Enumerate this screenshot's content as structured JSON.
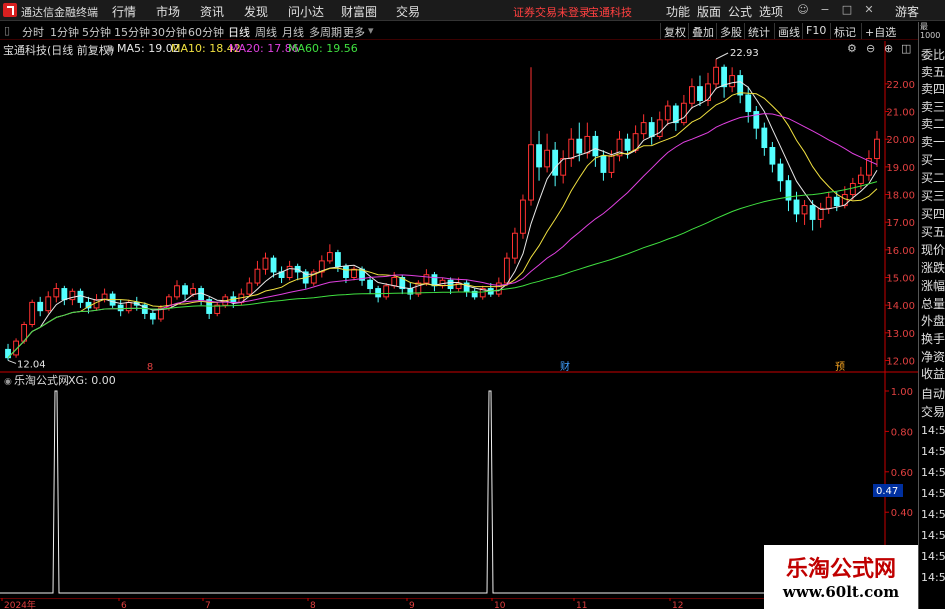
{
  "menubar": {
    "app_title": "通达信金融终端",
    "menus": [
      "行情",
      "市场",
      "资讯",
      "发现",
      "问小达",
      "财富圈",
      "交易"
    ],
    "status_text": "证券交易未登录",
    "stock_name": "宝通科技",
    "right_menus": [
      "功能",
      "版面",
      "公式",
      "选项"
    ],
    "user": "游客"
  },
  "toolbar": {
    "periods": [
      "分时",
      "1分钟",
      "5分钟",
      "15分钟",
      "30分钟",
      "60分钟",
      "日线",
      "周线",
      "月线",
      "多周期",
      "更多"
    ],
    "active_period": "日线",
    "right_buttons": [
      "复权",
      "叠加",
      "多股",
      "统计",
      "画线",
      "F10",
      "标记",
      "+自选"
    ]
  },
  "info": {
    "title": "宝通科技(日线 前复权)",
    "ma5": "MA5: 19.02",
    "ma10": "MA10: 18.42",
    "ma20": "MA20: 17.86",
    "ma60": "MA60: 19.56"
  },
  "colors": {
    "up": "#ff3232",
    "down": "#54ffff",
    "ma5": "#e8e8e8",
    "ma10": "#f0e040",
    "ma20": "#e040e0",
    "ma60": "#40e040",
    "grid": "#5a0000",
    "axis": "#c80000"
  },
  "price_axis": {
    "labels": [
      "22.00",
      "21.00",
      "20.00",
      "19.00",
      "18.00",
      "17.00",
      "16.00",
      "15.00",
      "14.00",
      "13.00",
      "12.00"
    ],
    "high_label": "22.93",
    "low_label": "12.04"
  },
  "markers": [
    "8",
    "财",
    "预"
  ],
  "sub_indicator": {
    "title": "乐淘公式网",
    "value": "XG: 0.00",
    "axis_labels": [
      "1.00",
      "0.80",
      "0.60",
      "0.40",
      "0.20"
    ],
    "cursor_value": "0.47"
  },
  "x_axis": {
    "labels": [
      "2024年",
      "6",
      "7",
      "8",
      "9",
      "10",
      "11",
      "12"
    ]
  },
  "right_panel": {
    "top_small": [
      "最",
      "1000"
    ],
    "labels": [
      "委比",
      "卖五",
      "卖四",
      "卖三",
      "卖二",
      "卖一",
      "买一",
      "买二",
      "买三",
      "买四",
      "买五",
      "现价",
      "涨跌",
      "涨幅",
      "总量",
      "外盘",
      "换手",
      "净资",
      "收益",
      "自动",
      "交易"
    ],
    "times": [
      "14:56",
      "14:56",
      "14:56",
      "14:56",
      "14:56",
      "14:56",
      "14:56",
      "14:56"
    ]
  },
  "watermark": {
    "title": "乐淘公式网",
    "url": "www.60lt.com"
  },
  "chart_data": {
    "type": "candlestick",
    "ylim": [
      11.8,
      22.9
    ],
    "candles": [
      [
        12.4,
        12.1,
        12.6,
        12.0
      ],
      [
        12.2,
        12.7,
        12.8,
        12.1
      ],
      [
        12.7,
        13.3,
        13.4,
        12.6
      ],
      [
        13.3,
        14.1,
        14.2,
        13.2
      ],
      [
        14.1,
        13.8,
        14.3,
        13.6
      ],
      [
        13.8,
        14.3,
        14.5,
        13.7
      ],
      [
        14.3,
        14.6,
        14.8,
        14.1
      ],
      [
        14.6,
        14.2,
        14.7,
        14.0
      ],
      [
        14.2,
        14.5,
        14.6,
        14.0
      ],
      [
        14.5,
        14.1,
        14.6,
        13.9
      ],
      [
        14.1,
        13.9,
        14.3,
        13.7
      ],
      [
        13.9,
        14.2,
        14.4,
        13.8
      ],
      [
        14.2,
        14.4,
        14.6,
        14.1
      ],
      [
        14.4,
        14.0,
        14.5,
        13.9
      ],
      [
        14.0,
        13.8,
        14.2,
        13.6
      ],
      [
        13.8,
        14.1,
        14.2,
        13.7
      ],
      [
        14.1,
        14.0,
        14.3,
        13.8
      ],
      [
        14.0,
        13.7,
        14.1,
        13.5
      ],
      [
        13.7,
        13.5,
        13.8,
        13.3
      ],
      [
        13.5,
        13.9,
        14.0,
        13.4
      ],
      [
        13.9,
        14.3,
        14.4,
        13.8
      ],
      [
        14.3,
        14.7,
        14.9,
        14.2
      ],
      [
        14.7,
        14.4,
        14.8,
        14.2
      ],
      [
        14.4,
        14.6,
        14.8,
        14.3
      ],
      [
        14.6,
        14.2,
        14.7,
        14.0
      ],
      [
        14.2,
        13.7,
        14.3,
        13.5
      ],
      [
        13.7,
        14.0,
        14.1,
        13.6
      ],
      [
        14.0,
        14.3,
        14.4,
        13.9
      ],
      [
        14.3,
        14.1,
        14.5,
        13.9
      ],
      [
        14.1,
        14.4,
        14.6,
        14.0
      ],
      [
        14.4,
        14.8,
        15.0,
        14.3
      ],
      [
        14.8,
        15.3,
        15.6,
        14.7
      ],
      [
        15.3,
        15.7,
        15.9,
        15.1
      ],
      [
        15.7,
        15.2,
        15.8,
        15.0
      ],
      [
        15.2,
        15.0,
        15.4,
        14.8
      ],
      [
        15.0,
        15.4,
        15.6,
        14.9
      ],
      [
        15.4,
        15.2,
        15.5,
        14.9
      ],
      [
        15.2,
        14.8,
        15.3,
        14.6
      ],
      [
        14.8,
        15.2,
        15.3,
        14.7
      ],
      [
        15.2,
        15.6,
        15.8,
        15.0
      ],
      [
        15.6,
        15.9,
        16.2,
        15.5
      ],
      [
        15.9,
        15.4,
        16.0,
        15.2
      ],
      [
        15.4,
        15.0,
        15.5,
        14.8
      ],
      [
        15.0,
        15.3,
        15.4,
        14.9
      ],
      [
        15.3,
        14.9,
        15.4,
        14.7
      ],
      [
        14.9,
        14.6,
        15.0,
        14.4
      ],
      [
        14.6,
        14.3,
        14.7,
        14.1
      ],
      [
        14.3,
        14.7,
        14.8,
        14.2
      ],
      [
        14.7,
        15.0,
        15.2,
        14.6
      ],
      [
        15.0,
        14.6,
        15.1,
        14.4
      ],
      [
        14.6,
        14.4,
        14.8,
        14.2
      ],
      [
        14.4,
        14.8,
        14.9,
        14.3
      ],
      [
        14.8,
        15.1,
        15.3,
        14.7
      ],
      [
        15.1,
        14.7,
        15.2,
        14.5
      ],
      [
        14.7,
        14.9,
        15.0,
        14.6
      ],
      [
        14.9,
        14.6,
        15.0,
        14.4
      ],
      [
        14.6,
        14.8,
        15.0,
        14.5
      ],
      [
        14.8,
        14.5,
        14.9,
        14.3
      ],
      [
        14.5,
        14.3,
        14.6,
        14.2
      ],
      [
        14.3,
        14.6,
        14.7,
        14.2
      ],
      [
        14.6,
        14.4,
        14.8,
        14.3
      ],
      [
        14.4,
        14.8,
        15.0,
        14.3
      ],
      [
        14.8,
        15.7,
        15.9,
        14.7
      ],
      [
        15.7,
        16.6,
        16.8,
        15.5
      ],
      [
        16.6,
        17.8,
        18.0,
        16.4
      ],
      [
        17.8,
        19.8,
        22.6,
        17.6
      ],
      [
        19.8,
        19.0,
        20.3,
        18.5
      ],
      [
        19.0,
        19.6,
        20.2,
        18.8
      ],
      [
        19.6,
        18.7,
        19.9,
        18.3
      ],
      [
        18.7,
        19.3,
        19.6,
        18.4
      ],
      [
        19.3,
        20.0,
        20.4,
        19.0
      ],
      [
        20.0,
        19.5,
        20.6,
        19.2
      ],
      [
        19.5,
        20.1,
        20.6,
        19.3
      ],
      [
        20.1,
        19.4,
        20.3,
        19.0
      ],
      [
        19.4,
        18.8,
        19.6,
        18.5
      ],
      [
        18.8,
        19.4,
        19.6,
        18.6
      ],
      [
        19.4,
        20.0,
        20.3,
        19.2
      ],
      [
        20.0,
        19.6,
        20.2,
        19.3
      ],
      [
        19.6,
        20.2,
        20.5,
        19.5
      ],
      [
        20.2,
        20.6,
        20.9,
        20.0
      ],
      [
        20.6,
        20.1,
        20.8,
        19.8
      ],
      [
        20.1,
        20.7,
        21.0,
        20.0
      ],
      [
        20.7,
        21.2,
        21.4,
        20.5
      ],
      [
        21.2,
        20.6,
        21.3,
        20.3
      ],
      [
        20.6,
        21.3,
        21.6,
        20.5
      ],
      [
        21.3,
        21.9,
        22.2,
        21.1
      ],
      [
        21.9,
        21.4,
        22.3,
        21.2
      ],
      [
        21.4,
        22.0,
        22.4,
        21.2
      ],
      [
        22.0,
        22.6,
        22.9,
        21.8
      ],
      [
        22.6,
        21.9,
        22.7,
        21.5
      ],
      [
        21.9,
        22.3,
        22.6,
        21.7
      ],
      [
        22.3,
        21.6,
        22.5,
        21.3
      ],
      [
        21.6,
        21.0,
        21.9,
        20.6
      ],
      [
        21.0,
        20.4,
        21.2,
        20.0
      ],
      [
        20.4,
        19.7,
        20.6,
        19.4
      ],
      [
        19.7,
        19.1,
        19.9,
        18.8
      ],
      [
        19.1,
        18.5,
        19.3,
        18.1
      ],
      [
        18.5,
        17.8,
        18.7,
        17.4
      ],
      [
        17.8,
        17.3,
        18.1,
        17.0
      ],
      [
        17.3,
        17.6,
        17.8,
        16.9
      ],
      [
        17.6,
        17.1,
        17.8,
        16.7
      ],
      [
        17.1,
        17.5,
        17.7,
        16.8
      ],
      [
        17.5,
        17.9,
        18.1,
        17.3
      ],
      [
        17.9,
        17.6,
        18.1,
        17.4
      ],
      [
        17.6,
        18.0,
        18.3,
        17.5
      ],
      [
        18.0,
        18.4,
        18.6,
        17.8
      ],
      [
        18.4,
        18.7,
        19.0,
        18.2
      ],
      [
        18.7,
        19.3,
        19.6,
        18.5
      ],
      [
        19.3,
        20.0,
        20.3,
        19.0
      ]
    ],
    "signals": [
      0.0,
      1.0,
      0.0,
      0.0,
      0.0,
      0.0,
      1.0,
      0.0
    ]
  }
}
